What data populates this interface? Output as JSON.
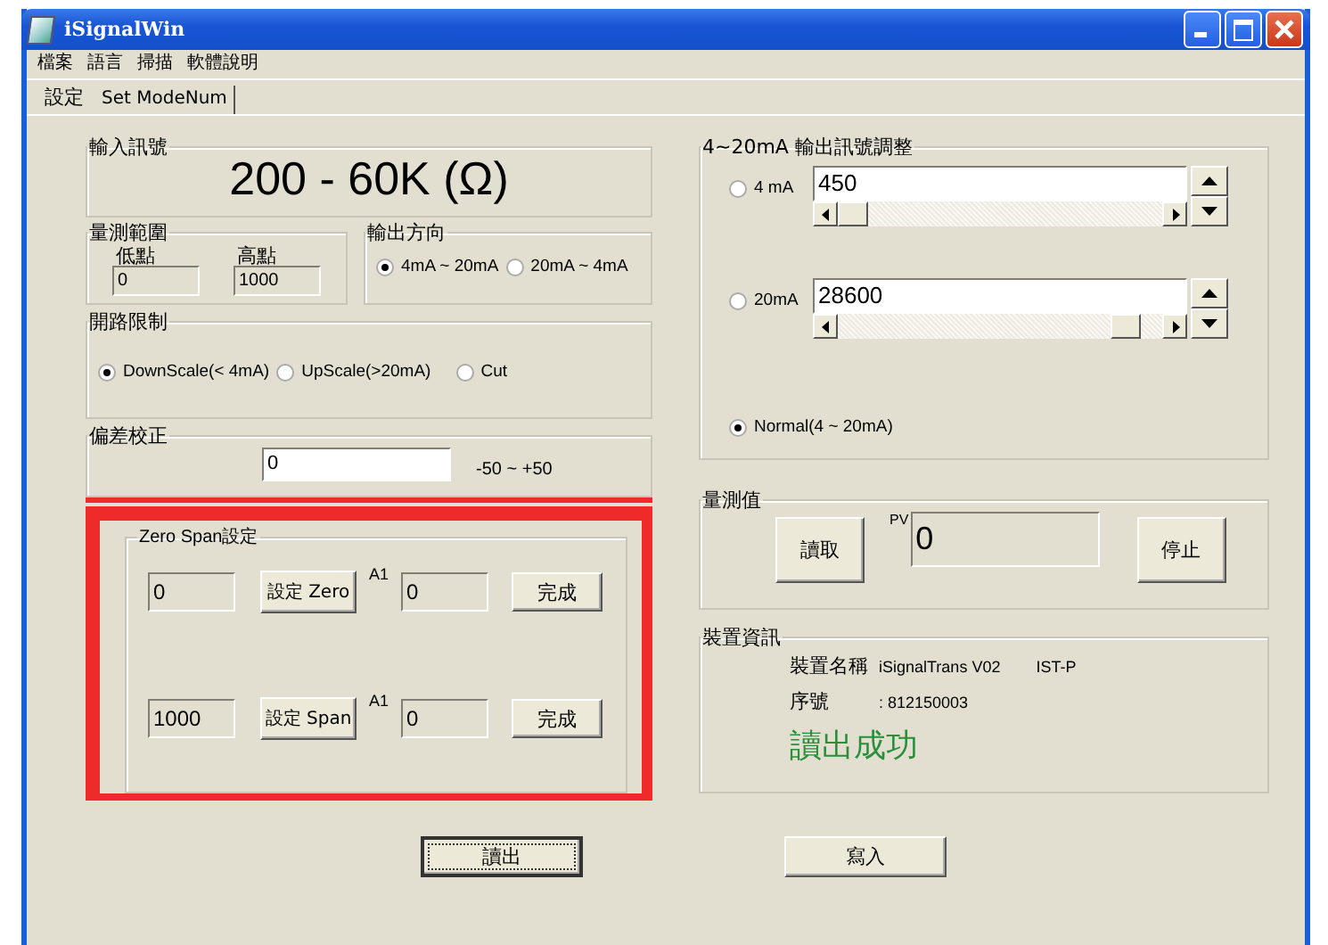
{
  "window": {
    "title": "iSignalWin"
  },
  "menu": [
    "檔案",
    "語言",
    "掃描",
    "軟體說明"
  ],
  "tabs": [
    {
      "label": "設定",
      "selected": true
    },
    {
      "label": "Set ModeNum",
      "selected": false
    }
  ],
  "input_signal": {
    "title": "輸入訊號",
    "value": "200 - 60K (Ω)"
  },
  "range": {
    "title": "量測範圍",
    "low_label": "低點",
    "low_value": "0",
    "high_label": "高點",
    "high_value": "1000"
  },
  "output_direction": {
    "title": "輸出方向",
    "options": [
      {
        "label": "4mA ~ 20mA",
        "selected": true
      },
      {
        "label": "20mA ~ 4mA",
        "selected": false
      }
    ]
  },
  "open_circuit": {
    "title": "開路限制",
    "options": [
      {
        "label": "DownScale(< 4mA)",
        "selected": true
      },
      {
        "label": "UpScale(>20mA)",
        "selected": false
      },
      {
        "label": "Cut",
        "selected": false
      }
    ]
  },
  "offset": {
    "title": "偏差校正",
    "value": "0",
    "range": "-50 ~ +50"
  },
  "zero_span": {
    "highlighted": true,
    "title": "Zero Span設定",
    "rows": [
      {
        "value": "0",
        "button": "設定 Zero",
        "a_label": "A1",
        "a_value": "0",
        "done": "完成"
      },
      {
        "value": "1000",
        "button": "設定 Span",
        "a_label": "A1",
        "a_value": "0",
        "done": "完成"
      }
    ]
  },
  "output_adjust": {
    "title": "4~20mA 輸出訊號調整",
    "channels": [
      {
        "label": "4 mA",
        "selected": false,
        "value": "450"
      },
      {
        "label": "20mA",
        "selected": false,
        "value": "28600"
      }
    ],
    "normal": {
      "label": "Normal(4 ~ 20mA)",
      "selected": true
    }
  },
  "measurement": {
    "title": "量測值",
    "read_button": "讀取",
    "pv_label": "PV",
    "pv_value": "0",
    "stop_button": "停止"
  },
  "device_info": {
    "title": "裝置資訊",
    "name_label": "裝置名稱",
    "name_value": "iSignalTrans V02",
    "model": "IST-P",
    "serial_label": "序號",
    "serial_value": ": 812150003",
    "status": "讀出成功"
  },
  "buttons": [
    {
      "label": "讀出",
      "focused": true
    },
    {
      "label": "寫入",
      "focused": false
    }
  ]
}
